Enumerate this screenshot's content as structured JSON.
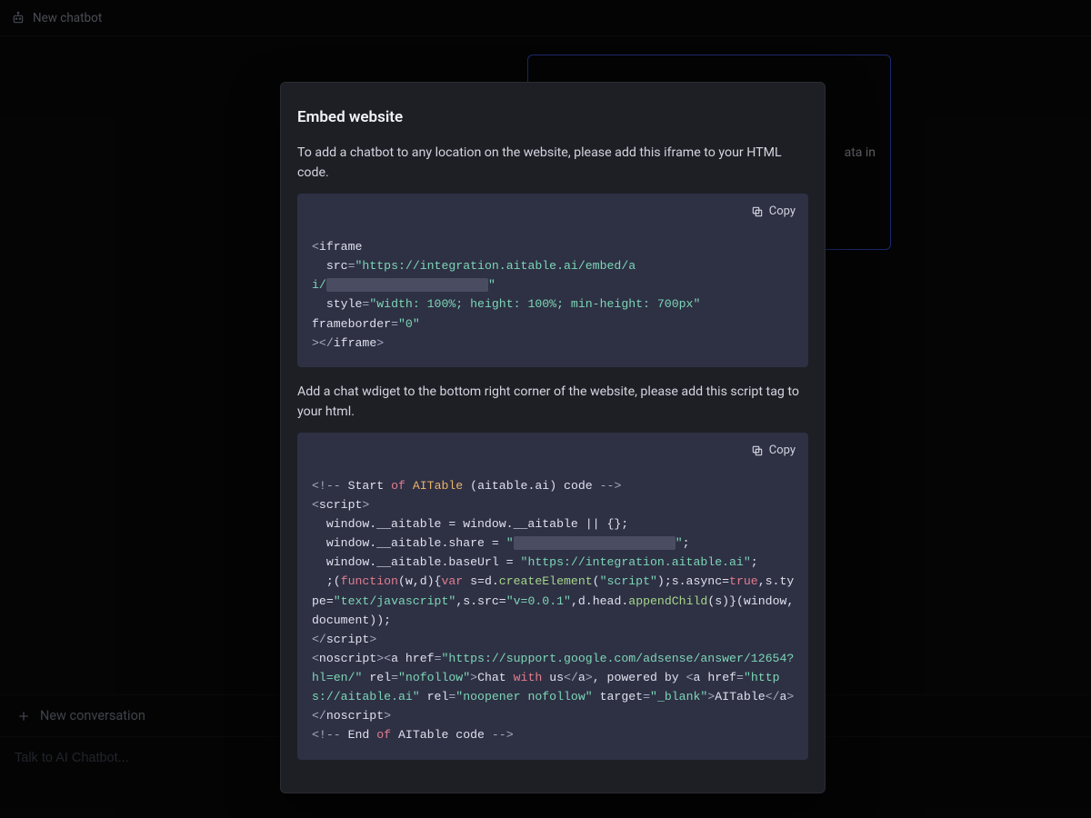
{
  "topbar": {
    "title": "New chatbot"
  },
  "card": {
    "partial_text": "ata in"
  },
  "bottom": {
    "new_conversation_label": "New conversation",
    "input_placeholder": "Talk to AI Chatbot..."
  },
  "modal": {
    "title": "Embed website",
    "paragraph1": "To add a chatbot to any location on the website, please add this iframe to your HTML code.",
    "paragraph2": "Add a chat wdiget to the bottom right corner of the website, please add this script tag to your html.",
    "copy_label": "Copy",
    "code1": {
      "src_url": "https://integration.aitable.ai/embed/ai/",
      "style": "width: 100%; height: 100%; min-height: 700px",
      "frameborder": "0"
    },
    "code2": {
      "comment_start": "Start",
      "of_word": "of",
      "product": "AITable",
      "product_domain": "(aitable.ai)",
      "code_word": "code",
      "share_placeholder": "",
      "base_url": "https://integration.aitable.ai",
      "script_src_suffix": "v=0.0.1",
      "noscript_href1": "https://support.google.com/adsense/answer/12654?hl=en/",
      "noscript_text1": "Chat",
      "noscript_with": "with",
      "noscript_us": "us",
      "noscript_powered": ", powered by ",
      "noscript_href2": "https://aitable.ai",
      "noscript_text2": "AITable",
      "comment_end": "End",
      "aitable_code": "AITable code",
      "script_type": "text/javascript",
      "rel1": "nofollow",
      "rel2": "noopener nofollow",
      "target": "_blank",
      "true": "true"
    }
  }
}
